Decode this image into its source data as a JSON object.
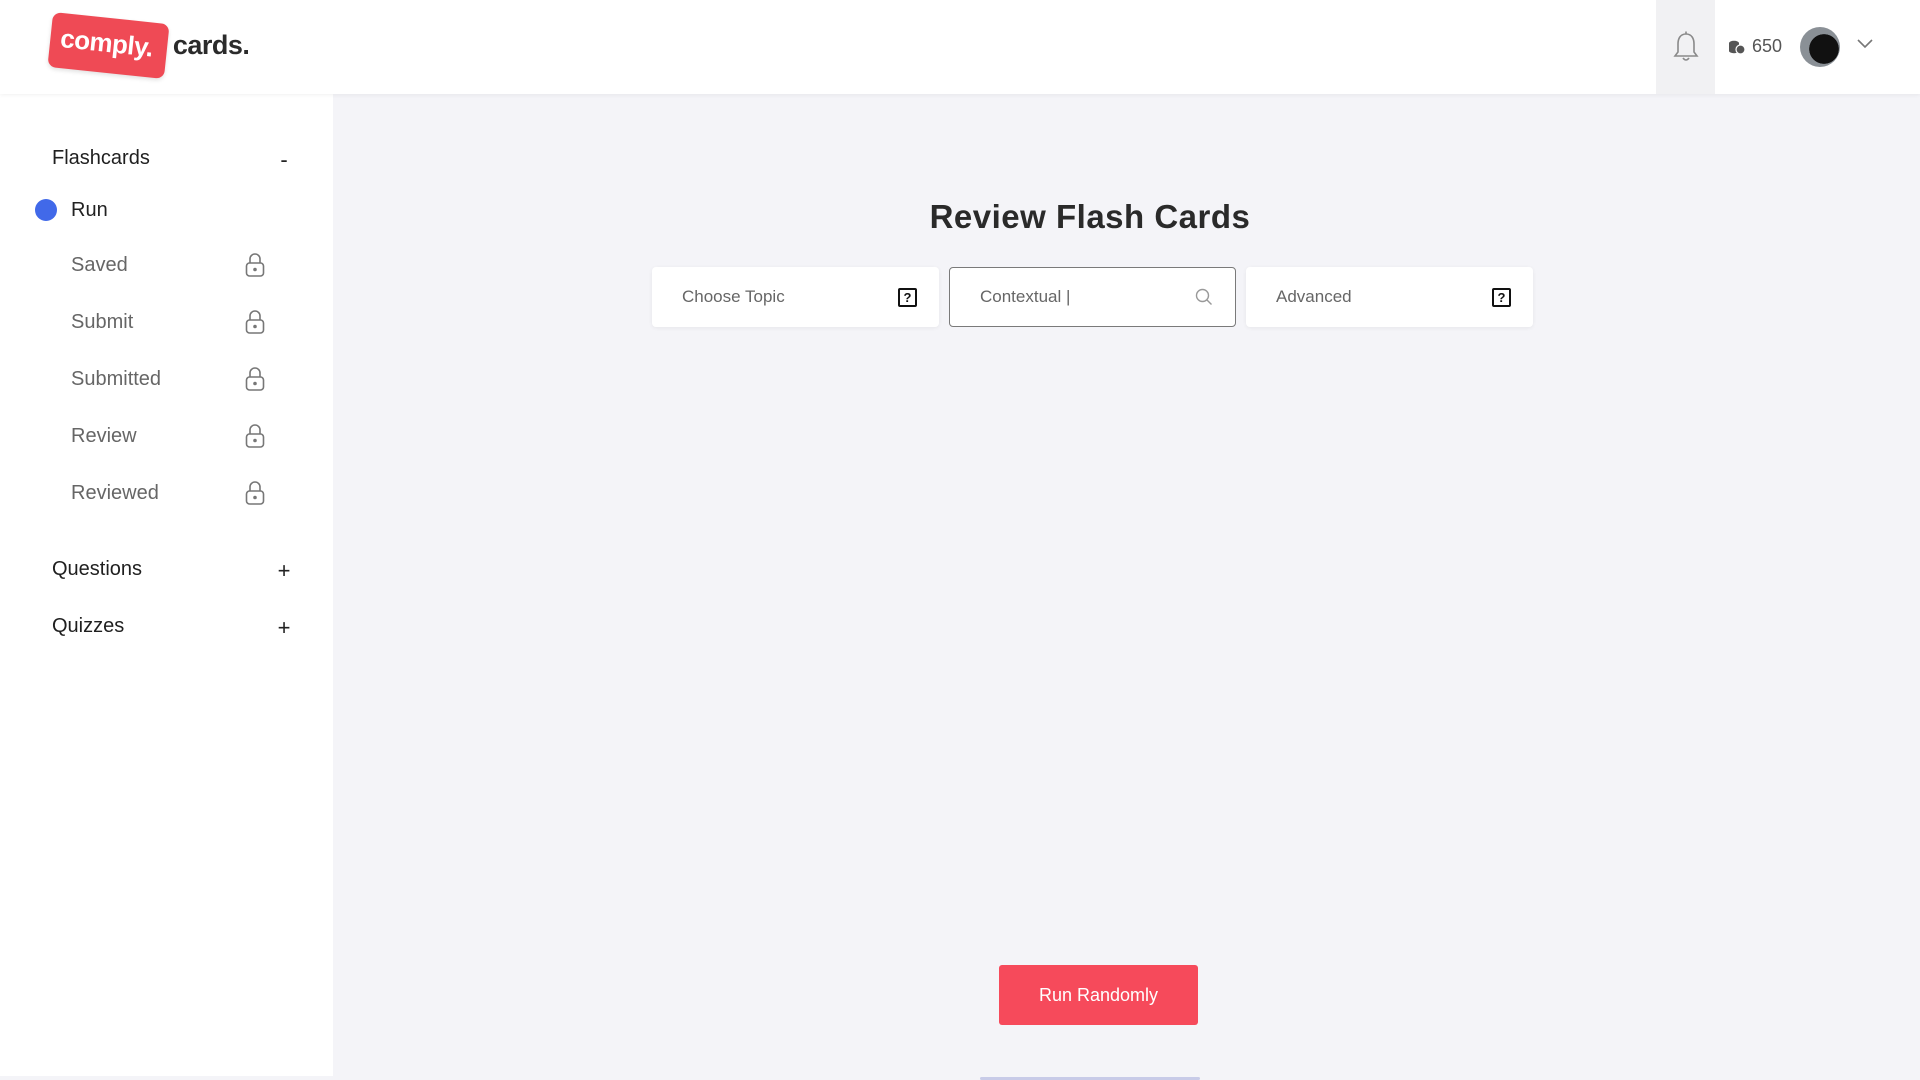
{
  "app": {
    "logo_badge": "comply.",
    "logo_text": "cards.",
    "coins": "650"
  },
  "sidebar": {
    "groups": [
      {
        "label": "Flashcards",
        "toggle": "-",
        "items": [
          {
            "label": "Run",
            "active": true,
            "locked": false
          },
          {
            "label": "Saved",
            "locked": true
          },
          {
            "label": "Submit",
            "locked": true
          },
          {
            "label": "Submitted",
            "locked": true
          },
          {
            "label": "Review",
            "locked": true
          },
          {
            "label": "Reviewed",
            "locked": true
          }
        ]
      },
      {
        "label": "Questions",
        "toggle": "+"
      },
      {
        "label": "Quizzes",
        "toggle": "+"
      }
    ]
  },
  "main": {
    "title": "Review Flash Cards",
    "filters": {
      "topic": "Choose Topic",
      "search_value": "Contextual |",
      "level": "Advanced",
      "help_glyph": "?"
    },
    "run_button": "Run Randomly"
  },
  "colors": {
    "accent": "#f64a5b",
    "active_dot": "#4169e9",
    "logo_badge": "#ef4a55"
  },
  "icons": [
    "bell-icon",
    "coins-icon",
    "chevron-down-icon",
    "lock-icon",
    "search-icon",
    "help-icon"
  ]
}
